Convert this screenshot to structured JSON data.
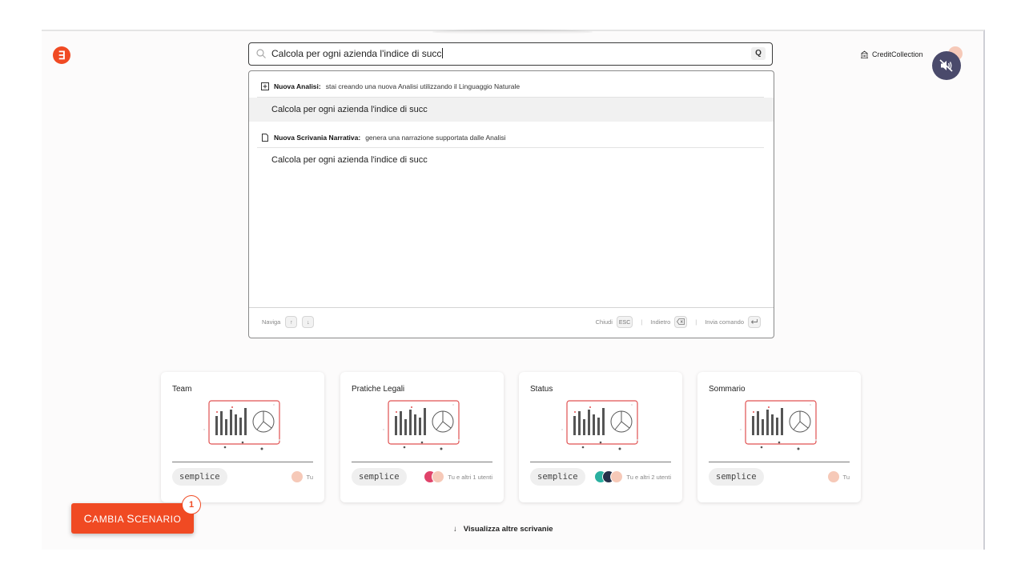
{
  "app": {
    "logo_glyph": "∃",
    "brand_color": "#f04a23"
  },
  "search": {
    "value": "Calcola per ogni azienda l'indice di succ",
    "shortcut_label": "Q"
  },
  "dropdown": {
    "sections": [
      {
        "icon": "plus-square-icon",
        "title": "Nuova Analisi:",
        "description": "stai creando una nuova Analisi utilizzando il Linguaggio Naturale",
        "suggestion": "Calcola per ogni azienda l'indice di succ"
      },
      {
        "icon": "document-icon",
        "title": "Nuova Scrivania Narrativa:",
        "description": "genera una narrazione supportata dalle Analisi",
        "suggestion": "Calcola per ogni azienda l'indice di succ"
      }
    ],
    "footer": {
      "navigate_label": "Naviga",
      "close_label": "Chiudi",
      "close_key": "ESC",
      "back_label": "Indietro",
      "send_label": "Invia comando",
      "separator": "|"
    }
  },
  "header": {
    "workspace_label": "CreditCollection"
  },
  "cards": [
    {
      "title": "Team",
      "tag": "semplice",
      "users_text": "Tu",
      "avatars": [
        "#f6c9b8"
      ]
    },
    {
      "title": "Pratiche Legali",
      "tag": "semplice",
      "users_text": "Tu e altri 1 utenti",
      "avatars": [
        "#e0436a",
        "#f6c9b8"
      ]
    },
    {
      "title": "Status",
      "tag": "semplice",
      "users_text": "Tu e altri 2 utenti",
      "avatars": [
        "#2ab0a0",
        "#26304a",
        "#f6c9b8"
      ]
    },
    {
      "title": "Sommario",
      "tag": "semplice",
      "users_text": "Tu",
      "avatars": [
        "#f6c9b8"
      ]
    }
  ],
  "scenario_button": {
    "label_first": "C",
    "label_rest": "AMBIA ",
    "label_second": "S",
    "label_rest2": "CENARIO",
    "badge": "1"
  },
  "more_link": {
    "label": "Visualizza altre scrivanie",
    "arrow": "↓"
  }
}
